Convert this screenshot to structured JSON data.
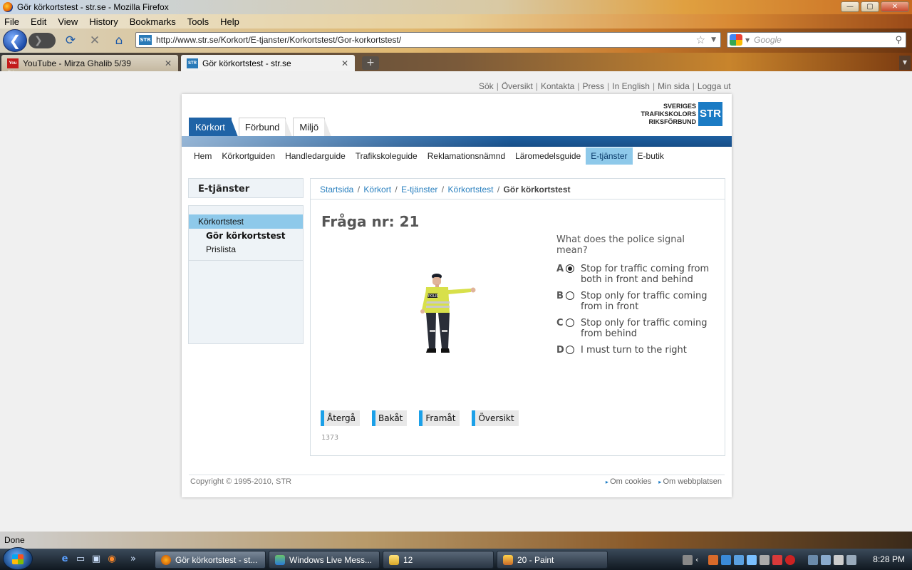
{
  "window": {
    "title": "Gör körkortstest - str.se - Mozilla Firefox",
    "minimize": "—",
    "maximize": "▢",
    "close": "✕"
  },
  "menu": [
    "File",
    "Edit",
    "View",
    "History",
    "Bookmarks",
    "Tools",
    "Help"
  ],
  "nav": {
    "back_glyph": "❮",
    "forward_glyph": "❯",
    "reload_glyph": "⟳",
    "stop_glyph": "✕",
    "home_glyph": "⌂",
    "site_badge": "STR",
    "url": "http://www.str.se/Korkort/E-tjanster/Korkortstest/Gor-korkortstest/",
    "bookmark_star": "☆",
    "dropdown": "▼",
    "search_placeholder": "Google",
    "search_glyph": "⚲"
  },
  "tabs": [
    {
      "favicon": "You Tube",
      "label": "YouTube - Mirza Ghalib 5/39",
      "close": "✕"
    },
    {
      "favicon": "STR",
      "label": "Gör körkortstest - str.se",
      "close": "✕"
    }
  ],
  "new_tab": "+",
  "tab_list": "▼",
  "page": {
    "top_links": [
      "Sök",
      "Översikt",
      "Kontakta",
      "Press",
      "In English",
      "Min sida",
      "Logga ut"
    ],
    "logo": {
      "line1": "SVERIGES",
      "line2": "TRAFIKSKOLORS",
      "line3": "RIKSFÖRBUND",
      "mark": "STR"
    },
    "main_tabs": [
      "Körkort",
      "Förbund",
      "Miljö"
    ],
    "subnav": [
      "Hem",
      "Körkortguiden",
      "Handledarguide",
      "Trafikskoleguide",
      "Reklamationsnämnd",
      "Läromedelsguide",
      "E-tjänster",
      "E-butik"
    ],
    "sidebar": {
      "heading": "E-tjänster",
      "items": [
        "Körkortstest",
        "Gör körkortstest",
        "Prislista"
      ]
    },
    "breadcrumb": [
      "Startsida",
      "Körkort",
      "E-tjänster",
      "Körkortstest",
      "Gör körkortstest"
    ],
    "question_title": "Fråga nr: 21",
    "figure_badge": "POLIS",
    "question": "What does the police signal mean?",
    "answers": [
      {
        "letter": "A",
        "text": "Stop for traffic coming from both in front and behind",
        "selected": true
      },
      {
        "letter": "B",
        "text": "Stop only for traffic coming from in front",
        "selected": false
      },
      {
        "letter": "C",
        "text": "Stop only for traffic coming from behind",
        "selected": false
      },
      {
        "letter": "D",
        "text": "I must turn to the right",
        "selected": false
      }
    ],
    "buttons": [
      "Återgå",
      "Bakåt",
      "Framåt",
      "Översikt"
    ],
    "question_id": "1373",
    "copyright": "Copyright © 1995-2010, STR",
    "footer_links": [
      "Om cookies",
      "Om webbplatsen"
    ]
  },
  "status": "Done",
  "taskbar": {
    "quicklaunch": [
      "e",
      "▭",
      "▣",
      "◉",
      "»"
    ],
    "tasks": [
      "Gör körkortstest - st...",
      "Windows Live Mess...",
      "12",
      "20 - Paint"
    ],
    "clock": "8:28 PM"
  },
  "colors": {
    "accent_blue": "#1f63a6",
    "subnav_active": "#8ec9ea",
    "link_blue": "#2a80bf",
    "button_accent": "#1ba0e8"
  }
}
